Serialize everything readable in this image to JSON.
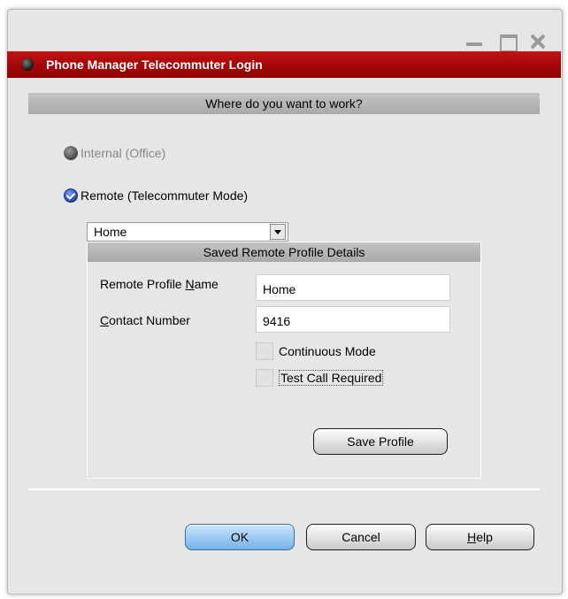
{
  "window": {
    "title": "Phone Manager Telecommuter Login",
    "controls": [
      "minimize-icon",
      "maximize-icon",
      "close-icon"
    ]
  },
  "location": {
    "header": "Where do you want to work?",
    "internal_label": "Internal (Office)",
    "internal_enabled": false,
    "remote_label": "Remote (Telecommuter Mode)",
    "remote_selected": true
  },
  "profile_select": {
    "selected": "Home"
  },
  "profile_details": {
    "header": "Saved Remote Profile Details",
    "name_label_prefix": "Remote Profile ",
    "name_label_accel": "N",
    "name_label_suffix": "ame",
    "name_value": "Home",
    "contact_label_accel": "C",
    "contact_label_suffix": "ontact Number",
    "contact_value": "9416",
    "continuous_label": "Continuous Mode",
    "continuous_checked": false,
    "test_call_label": "Test Call Required",
    "test_call_checked": false,
    "save_label": "Save Profile"
  },
  "buttons": {
    "ok": "OK",
    "cancel": "Cancel",
    "help_accel": "H",
    "help_suffix": "elp"
  },
  "colors": {
    "title_bar": "#b00808",
    "ok_button": "#8ec6f2",
    "window_bg": "#e6e6e6"
  }
}
